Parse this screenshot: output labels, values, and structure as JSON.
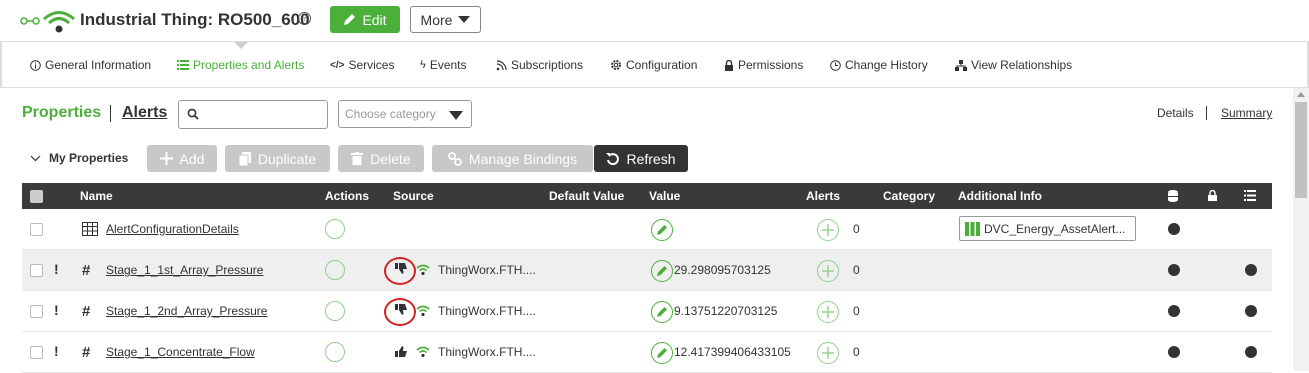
{
  "header": {
    "title": "Industrial Thing: RO500_600",
    "help": "?",
    "edit_label": "Edit",
    "more_label": "More"
  },
  "tabs": [
    {
      "label": "General Information",
      "icon": "info-icon"
    },
    {
      "label": "Properties and Alerts",
      "icon": "list-icon",
      "active": true
    },
    {
      "label": "Services",
      "icon": "code-icon"
    },
    {
      "label": "Events",
      "icon": "bolt-icon"
    },
    {
      "label": "Subscriptions",
      "icon": "rss-icon"
    },
    {
      "label": "Configuration",
      "icon": "gear-icon"
    },
    {
      "label": "Permissions",
      "icon": "lock-icon"
    },
    {
      "label": "Change History",
      "icon": "clock-icon"
    },
    {
      "label": "View Relationships",
      "icon": "sitemap-icon"
    }
  ],
  "subbar": {
    "properties": "Properties",
    "alerts": "Alerts",
    "search_placeholder": "",
    "category_placeholder": "Choose category",
    "details": "Details",
    "summary": "Summary"
  },
  "toolbar": {
    "my_properties": "My Properties",
    "add": "Add",
    "duplicate": "Duplicate",
    "delete": "Delete",
    "manage_bindings": "Manage Bindings",
    "refresh": "Refresh"
  },
  "columns": [
    "Name",
    "Actions",
    "Source",
    "Default Value",
    "Value",
    "Alerts",
    "Category",
    "Additional Info"
  ],
  "rows": [
    {
      "name": "AlertConfigurationDetails",
      "icon": "table-icon",
      "source": "",
      "value": "",
      "alerts": "0",
      "info": "DVC_Energy_AssetAlert...",
      "db": true,
      "list": false
    },
    {
      "name": "Stage_1_1st_Array_Pressure",
      "icon": "hash-icon",
      "source": "ThingWorx.FTH....",
      "value": "29.298095703125",
      "alerts": "0",
      "info": "",
      "db": true,
      "list": true
    },
    {
      "name": "Stage_1_2nd_Array_Pressure",
      "icon": "hash-icon",
      "source": "ThingWorx.FTH....",
      "value": "9.13751220703125",
      "alerts": "0",
      "info": "",
      "db": true,
      "list": true
    },
    {
      "name": "Stage_1_Concentrate_Flow",
      "icon": "hash-icon",
      "source": "ThingWorx.FTH....",
      "value": "12.417399406433105",
      "alerts": "0",
      "info": "",
      "db": true,
      "list": true
    }
  ],
  "colors": {
    "accent": "#4caf3a",
    "header_bg": "#3a3a3a",
    "highlight": "#d32020"
  }
}
